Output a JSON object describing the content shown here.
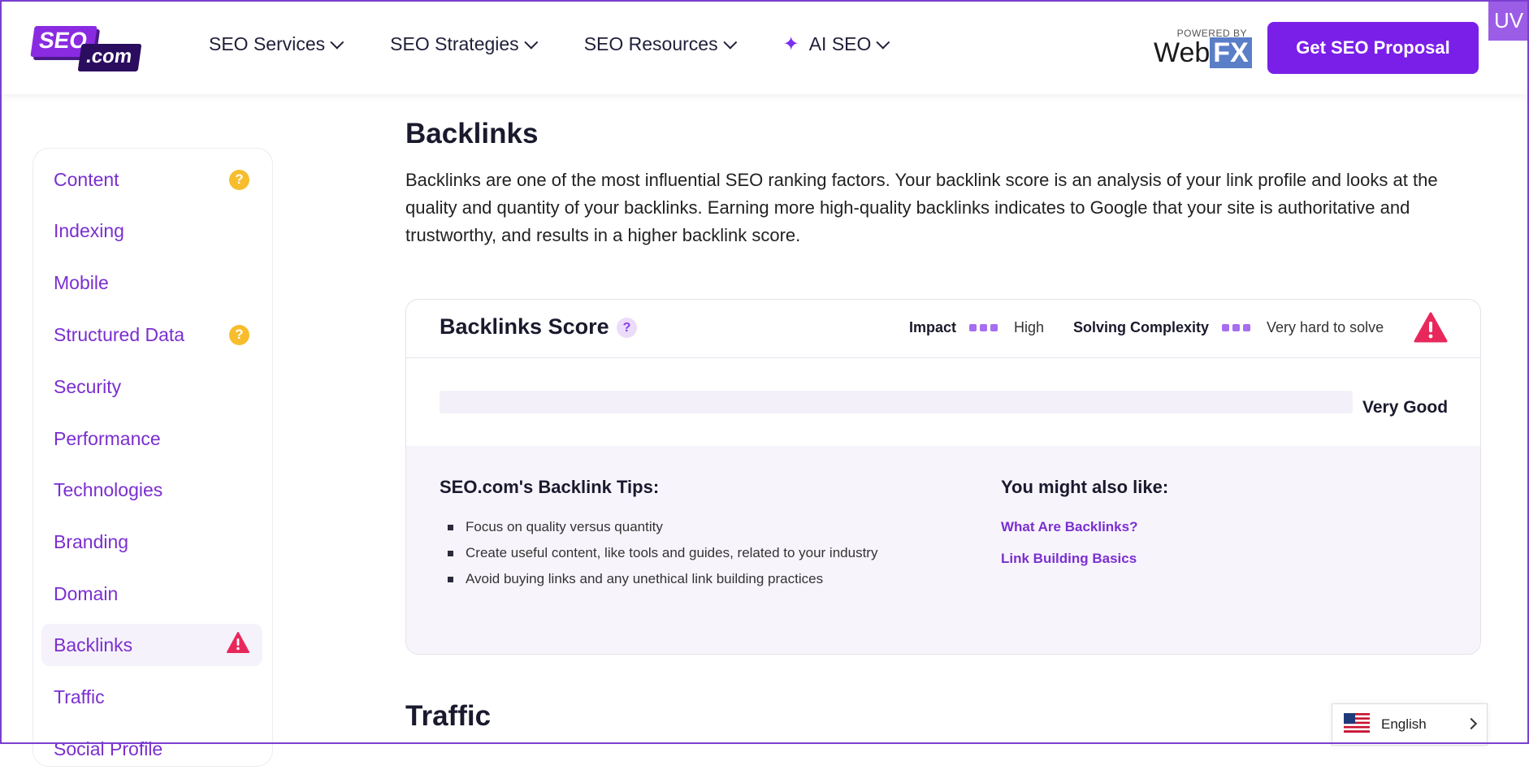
{
  "header": {
    "logo": {
      "part1": "SEO",
      "part2": ".com"
    },
    "nav": [
      {
        "label": "SEO Services"
      },
      {
        "label": "SEO Strategies"
      },
      {
        "label": "SEO Resources"
      },
      {
        "label": "AI SEO"
      }
    ],
    "powered_by": "POWERED BY",
    "webfx_part1": "Web",
    "webfx_part2": "FX",
    "cta": "Get SEO Proposal",
    "uv_badge": "UV"
  },
  "sidebar": {
    "items": [
      {
        "label": "Content",
        "badge": "?"
      },
      {
        "label": "Indexing"
      },
      {
        "label": "Mobile"
      },
      {
        "label": "Structured Data",
        "badge": "?"
      },
      {
        "label": "Security"
      },
      {
        "label": "Performance"
      },
      {
        "label": "Technologies"
      },
      {
        "label": "Branding"
      },
      {
        "label": "Domain"
      },
      {
        "label": "Backlinks"
      },
      {
        "label": "Traffic"
      },
      {
        "label": "Social Profile"
      }
    ]
  },
  "main": {
    "title": "Backlinks",
    "description": "Backlinks are one of the most influential SEO ranking factors. Your backlink score is an analysis of your link profile and looks at the quality and quantity of your backlinks. Earning more high-quality backlinks indicates to Google that your site is authoritative and trustworthy, and results in a higher backlink score.",
    "card": {
      "title": "Backlinks Score",
      "help": "?",
      "impact_label": "Impact",
      "impact_value": "High",
      "complexity_label": "Solving Complexity",
      "complexity_value": "Very hard to solve",
      "score_fraction": 0.0,
      "rating": "Very Good",
      "tips_title": "SEO.com's Backlink Tips:",
      "tips": [
        "Focus on quality versus quantity",
        "Create useful content, like tools and guides, related to your industry",
        "Avoid buying links and any unethical link building practices"
      ],
      "also_title": "You might also like:",
      "also_links": [
        "What Are Backlinks?",
        "Link Building Basics"
      ]
    },
    "next_section_title": "Traffic"
  },
  "language": {
    "label": "English"
  },
  "colors": {
    "brand_purple": "#7a1fe8",
    "sidebar_link": "#7a2fd0",
    "warning_red": "#e8285b",
    "question_yellow": "#f7bd2d"
  }
}
